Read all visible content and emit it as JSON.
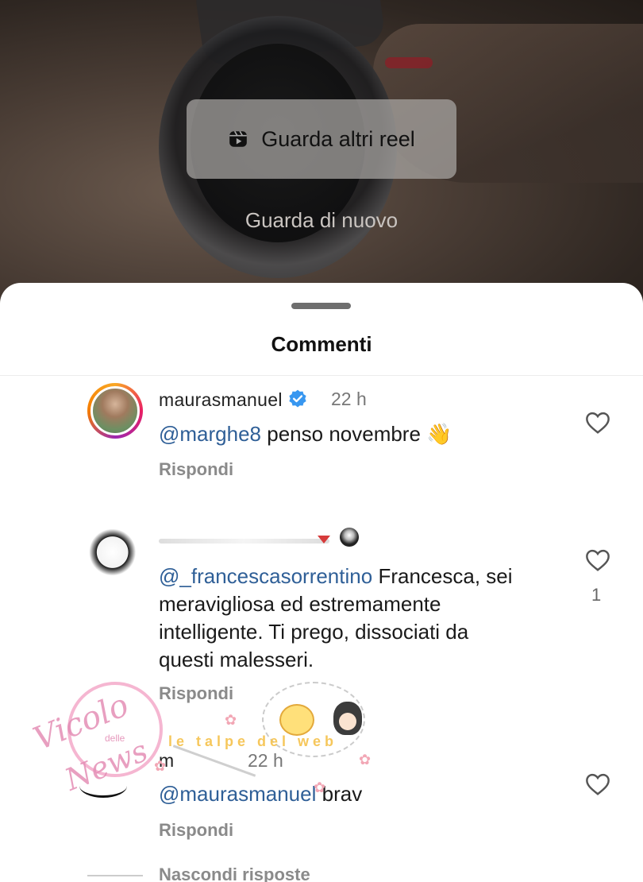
{
  "reel": {
    "more_reels_label": "Guarda altri reel",
    "replay_label": "Guarda di nuovo"
  },
  "sheet": {
    "title": "Commenti"
  },
  "comments": [
    {
      "username": "maurasmanuel",
      "verified": true,
      "time": "22 h",
      "mention": "@marghe8",
      "text": "penso novembre 👋",
      "reply_label": "Rispondi"
    },
    {
      "mention": "@_francescasorrentino",
      "text_line1": "Francesca, sei",
      "text_line2": "meravigliosa ed estremamente",
      "text_line3": "intelligente. Ti prego, dissociati da",
      "text_line4": "questi malesseri.",
      "likes": "1",
      "reply_label": "Rispondi"
    },
    {
      "username_partial": "m",
      "time": "22 h",
      "mention": "@maurasmanuel",
      "text": "brav",
      "reply_label": "Rispondi"
    }
  ],
  "hide_replies_label": "Nascondi risposte",
  "watermark": {
    "text_a": "Vicolo",
    "text_b": "News",
    "text_small": "delle",
    "banner": "le talpe del web"
  },
  "colors": {
    "mention": "#2f5f97",
    "verified": "#3897f0",
    "sheet_bg": "#ffffff"
  },
  "icons": [
    "reels-icon",
    "verified-badge-icon",
    "heart-icon"
  ]
}
